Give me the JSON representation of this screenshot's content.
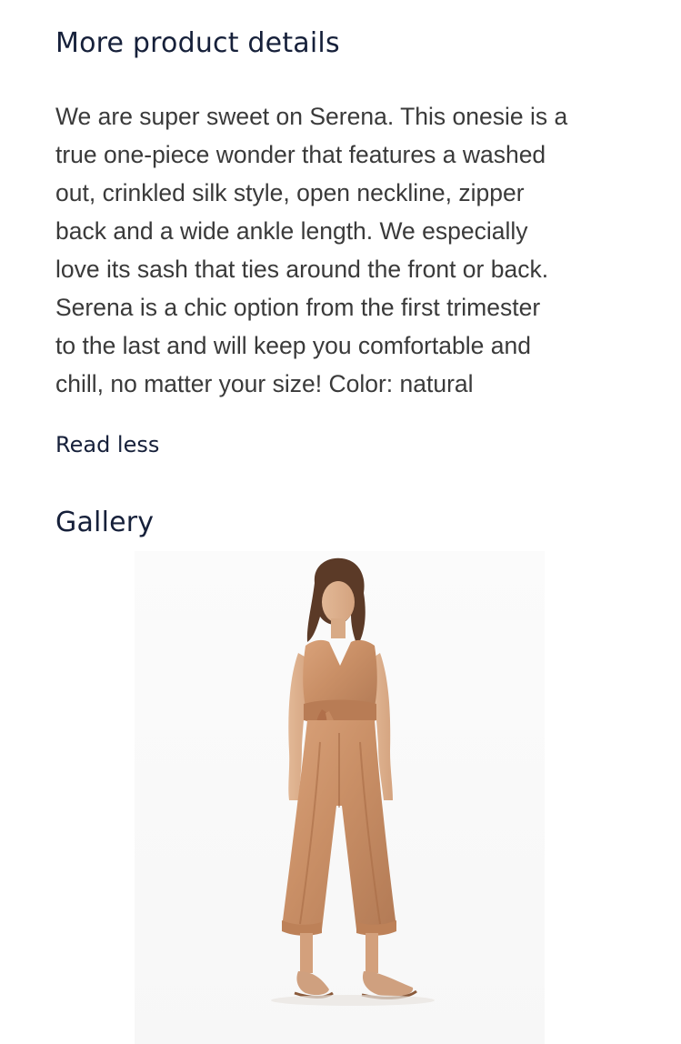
{
  "details": {
    "title": "More product details",
    "description": "We are super sweet on Serena. This onesie is a\ntrue one-piece wonder that features a washed\nout, crinkled silk style, open neckline, zipper\nback and a wide ankle length. We especially\nlove its sash that ties around the front or back.\nSerena is a chic option from the first trimester\nto the last and will keep you comfortable and\nchill, no matter your size! Color: natural",
    "read_less_label": "Read less"
  },
  "gallery": {
    "title": "Gallery",
    "image_alt": "Model wearing the Serena jumpsuit in natural"
  },
  "colors": {
    "heading": "#16203a",
    "body_text": "#3a3a3a",
    "jumpsuit": "#c98f66"
  }
}
